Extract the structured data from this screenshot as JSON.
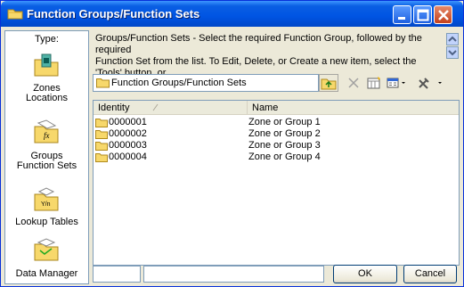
{
  "window": {
    "title": "Function Groups/Function Sets"
  },
  "sidebar": {
    "type_label": "Type:",
    "items": [
      {
        "label_line1": "Zones",
        "label_line2": "Locations"
      },
      {
        "label_line1": "Groups",
        "label_line2": "Function Sets"
      },
      {
        "label_line1": "Lookup Tables",
        "label_line2": ""
      },
      {
        "label_line1": "Data Manager",
        "label_line2": ""
      }
    ]
  },
  "description": {
    "line1": "Groups/Function Sets - Select the required Function Group, followed by the required",
    "line2": "Function Set from the list. To Edit, Delete, or Create a new item, select the 'Tools' button, or"
  },
  "path": {
    "text": "Function Groups/Function Sets"
  },
  "list": {
    "columns": {
      "identity": "Identity",
      "name": "Name"
    },
    "rows": [
      {
        "identity": "0000001",
        "name": "Zone or Group 1"
      },
      {
        "identity": "0000002",
        "name": "Zone or Group 2"
      },
      {
        "identity": "0000003",
        "name": "Zone or Group 3"
      },
      {
        "identity": "0000004",
        "name": "Zone or Group 4"
      }
    ]
  },
  "buttons": {
    "ok": "OK",
    "cancel": "Cancel"
  },
  "icons": {
    "folder": "folder-icon",
    "zones": "zones-locations-icon",
    "groups": "function-sets-icon",
    "lookup": "lookup-tables-icon",
    "datamanager": "data-manager-icon"
  },
  "colors": {
    "titlebar": "#0054e3",
    "folder": "#f7d86b",
    "panel": "#ece9d8"
  }
}
